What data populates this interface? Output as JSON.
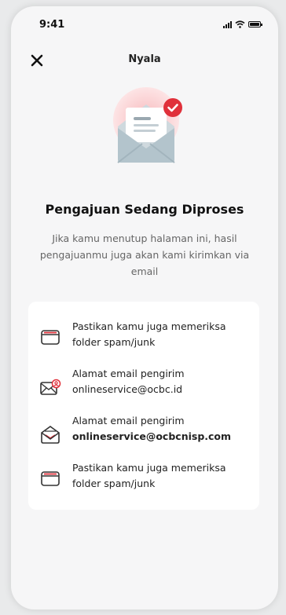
{
  "status_bar": {
    "time": "9:41"
  },
  "header": {
    "title": "Nyala"
  },
  "main": {
    "headline": "Pengajuan Sedang Diproses",
    "description": "Jika kamu menutup halaman ini, hasil pengajuanmu juga akan kami kirimkan via email"
  },
  "tips": [
    {
      "icon": "folder-icon",
      "line1": "Pastikan kamu juga memeriksa",
      "line2": "folder spam/junk"
    },
    {
      "icon": "email-sender-icon",
      "line1": "Alamat email pengirim",
      "line2": "onlineservice@ocbc.id"
    },
    {
      "icon": "open-envelope-icon",
      "line1": "Alamat email pengirim",
      "line2": "onlineservice@ocbcnisp.com"
    },
    {
      "icon": "folder-icon",
      "line1": "Pastikan kamu juga memeriksa",
      "line2": "folder spam/junk"
    }
  ],
  "colors": {
    "accent": "#e0303a",
    "background": "#f6f6f7",
    "card": "#ffffff"
  }
}
